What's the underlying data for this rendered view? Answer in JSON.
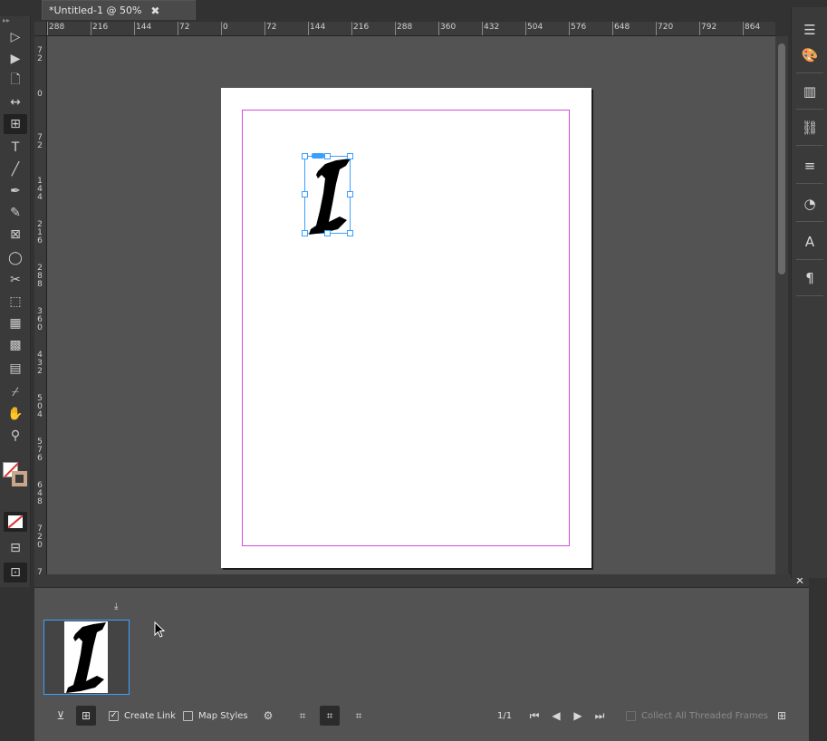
{
  "document_tab": {
    "title": "*Untitled-1 @ 50%",
    "close_glyph": "✖"
  },
  "ruler": {
    "h_ticks": [
      "288",
      "216",
      "144",
      "72",
      "0",
      "72",
      "144",
      "216",
      "288",
      "360",
      "432",
      "504",
      "576",
      "648",
      "720",
      "792",
      "864"
    ],
    "v_ticks": [
      "7\n2",
      "0",
      "7\n2",
      "1\n4\n4",
      "2\n1\n6",
      "2\n8\n8",
      "3\n6\n0",
      "4\n3\n2",
      "5\n0\n4",
      "5\n7\n6",
      "6\n4\n8",
      "7\n2\n0",
      "7"
    ]
  },
  "tools": [
    {
      "name": "selection-tool-icon",
      "glyph": "▷"
    },
    {
      "name": "direct-selection-tool-icon",
      "glyph": "▶"
    },
    {
      "name": "page-tool-icon",
      "glyph": "🗋"
    },
    {
      "name": "gap-tool-icon",
      "glyph": "↔"
    },
    {
      "name": "content-collector-tool-icon",
      "glyph": "⊞"
    },
    {
      "name": "type-tool-icon",
      "glyph": "T"
    },
    {
      "name": "line-tool-icon",
      "glyph": "╱"
    },
    {
      "name": "pen-tool-icon",
      "glyph": "✒"
    },
    {
      "name": "pencil-tool-icon",
      "glyph": "✎"
    },
    {
      "name": "rectangle-frame-tool-icon",
      "glyph": "⊠"
    },
    {
      "name": "ellipse-tool-icon",
      "glyph": "◯"
    },
    {
      "name": "scissors-tool-icon",
      "glyph": "✂"
    },
    {
      "name": "free-transform-tool-icon",
      "glyph": "⬚"
    },
    {
      "name": "gradient-swatch-tool-icon",
      "glyph": "▦"
    },
    {
      "name": "gradient-feather-tool-icon",
      "glyph": "▩"
    },
    {
      "name": "note-tool-icon",
      "glyph": "▤"
    },
    {
      "name": "eyedropper-tool-icon",
      "glyph": "⌿"
    },
    {
      "name": "hand-tool-icon",
      "glyph": "✋"
    },
    {
      "name": "zoom-tool-icon",
      "glyph": "⚲"
    }
  ],
  "right_dock": [
    {
      "name": "panel-menu-icon",
      "glyph": "☰"
    },
    {
      "name": "swatches-icon",
      "glyph": "🎨"
    },
    {
      "name": "pages-icon",
      "glyph": "▥"
    },
    {
      "name": "links-icon",
      "glyph": "⛓"
    },
    {
      "name": "stroke-icon",
      "glyph": "≡"
    },
    {
      "name": "color-icon",
      "glyph": "◔"
    },
    {
      "name": "character-styles-icon",
      "glyph": "A"
    },
    {
      "name": "paragraph-styles-icon",
      "glyph": "¶"
    }
  ],
  "conveyor": {
    "create_link_label": "Create Link",
    "create_link_checked": true,
    "map_styles_label": "Map Styles",
    "map_styles_checked": false,
    "page_count": "1/1",
    "collect_threaded_label": "Collect All Threaded Frames",
    "collect_threaded_checked": false
  },
  "colors": {
    "accent": "#3aa0ff",
    "margin_guide": "#d24bd6",
    "pasteboard": "#535353",
    "chrome": "#3a3a3a"
  }
}
